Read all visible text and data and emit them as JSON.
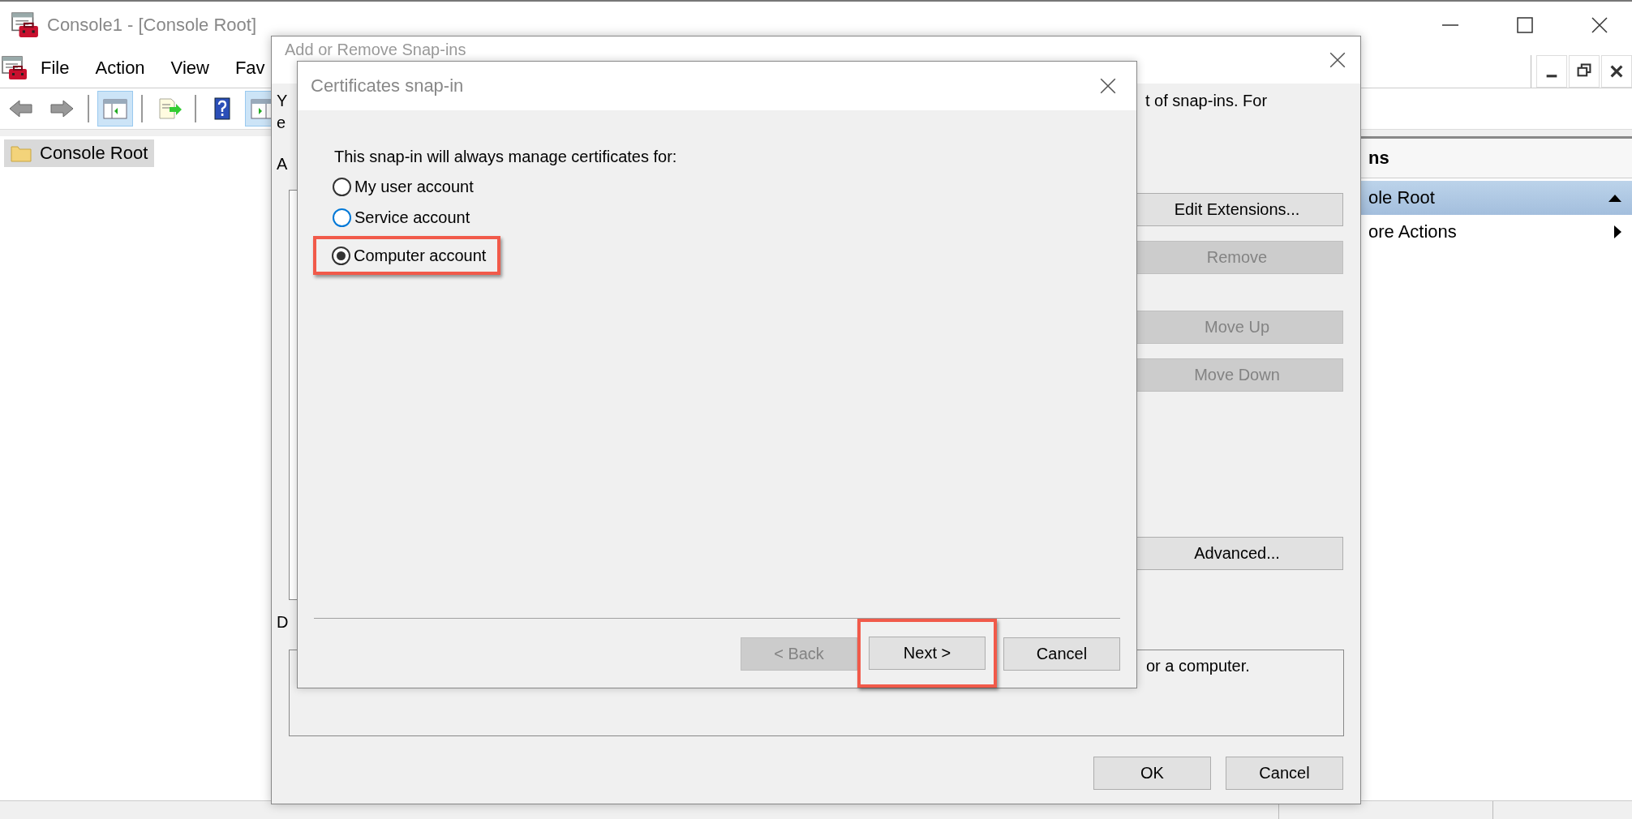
{
  "main_window": {
    "title": "Console1 - [Console Root]",
    "menu": [
      "File",
      "Action",
      "View",
      "Fav"
    ],
    "toolbar": [
      {
        "kind": "back",
        "pressed": false
      },
      {
        "kind": "forward",
        "pressed": false
      },
      {
        "kind": "tree",
        "pressed": true
      },
      {
        "kind": "export",
        "pressed": false
      },
      {
        "kind": "help",
        "pressed": false
      },
      {
        "kind": "actionpane",
        "pressed": true
      }
    ],
    "tree": [
      {
        "label": "Console Root",
        "selected": true
      }
    ],
    "actions_pane": {
      "header": "ns",
      "items": [
        {
          "kind": "group",
          "label": "ole Root",
          "expanded": true
        },
        {
          "kind": "submenu",
          "label": "ore Actions"
        }
      ]
    }
  },
  "snapin_dialog": {
    "title": "Add or Remove Snap-ins",
    "intro_start": [
      "Y",
      "e"
    ],
    "intro_end": "t of snap-ins. For",
    "list_label": "A",
    "side_buttons": [
      {
        "label": "Edit Extensions...",
        "disabled": false
      },
      {
        "label": "Remove",
        "disabled": true
      },
      {
        "label": "Move Up",
        "disabled": true
      },
      {
        "label": "Move Down",
        "disabled": true
      },
      {
        "label": "Advanced...",
        "disabled": false
      }
    ],
    "description_label": "D",
    "description_end": "or a computer.",
    "buttons": [
      "OK",
      "Cancel"
    ]
  },
  "cert_dialog": {
    "title": "Certificates snap-in",
    "prompt": "This snap-in will always manage certificates for:",
    "options": [
      {
        "label": "My user account",
        "selected": false,
        "hot": false,
        "annotated": false
      },
      {
        "label": "Service account",
        "selected": false,
        "hot": true,
        "annotated": false
      },
      {
        "label": "Computer account",
        "selected": true,
        "hot": false,
        "annotated": true
      }
    ],
    "buttons": [
      {
        "label": "< Back",
        "disabled": true,
        "annotated": false
      },
      {
        "label": "Next >",
        "disabled": false,
        "annotated": true
      },
      {
        "label": "Cancel",
        "disabled": false,
        "annotated": false
      }
    ]
  }
}
